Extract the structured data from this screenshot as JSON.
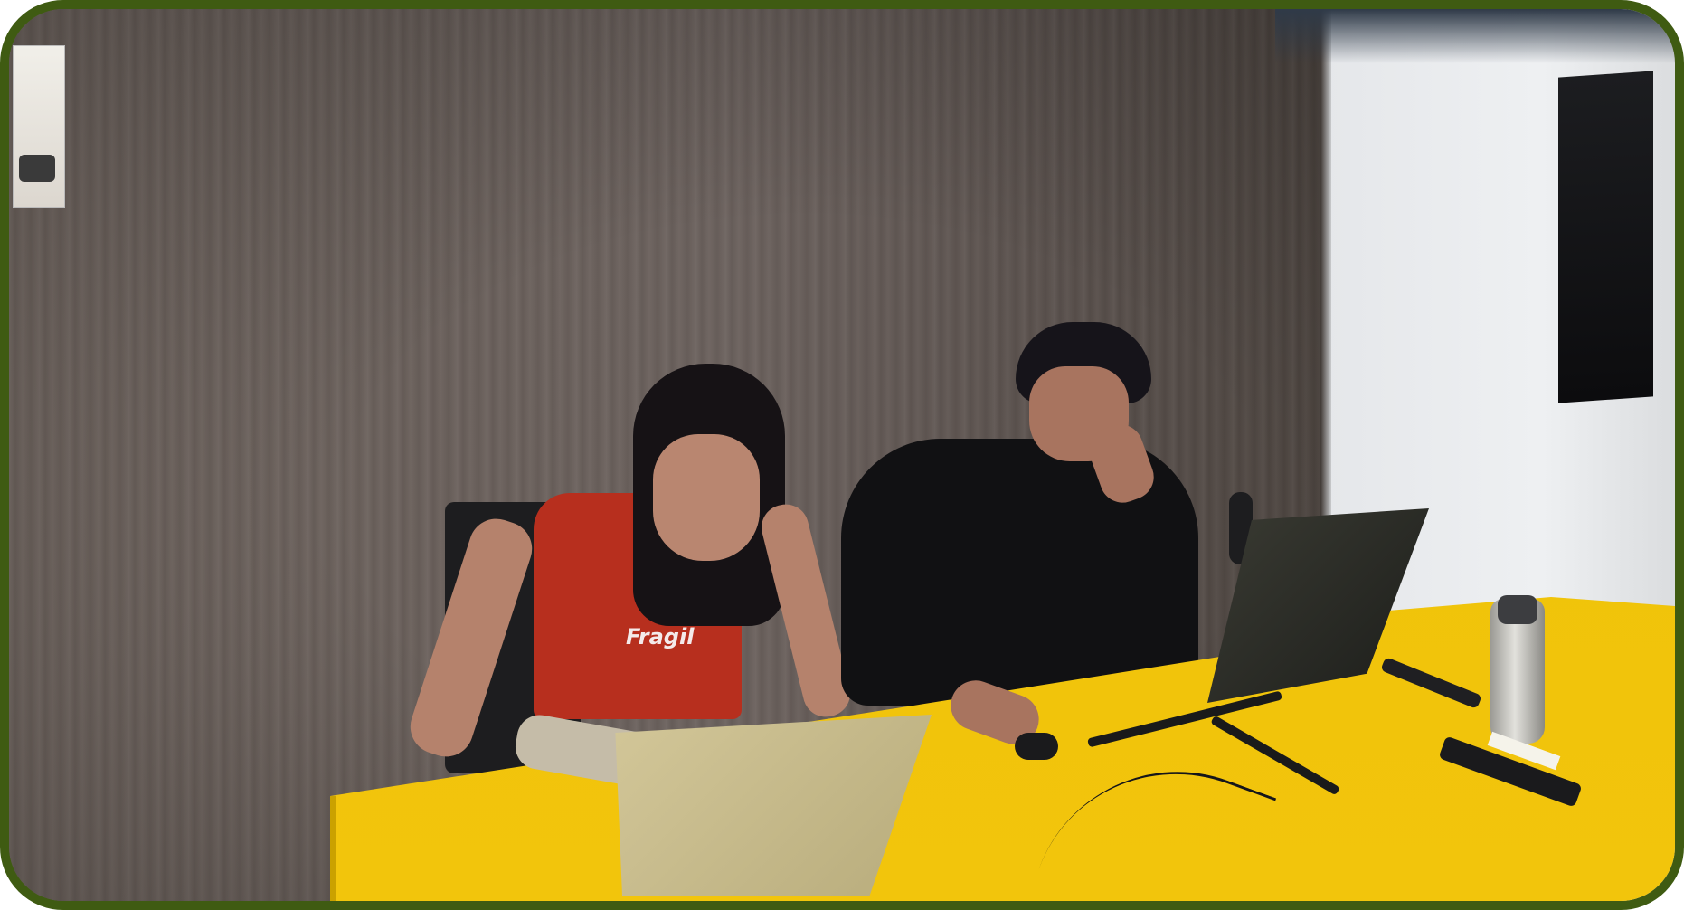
{
  "image": {
    "kind": "photograph",
    "frame_color": "#3f5b12"
  },
  "shirt_text": "Fragil",
  "colors": {
    "wall_wood": "#6b615c",
    "wall_white": "#eef0f2",
    "table_yellow": "#f0c30a",
    "red_top": "#b72f1e",
    "black_sweater": "#111113"
  }
}
